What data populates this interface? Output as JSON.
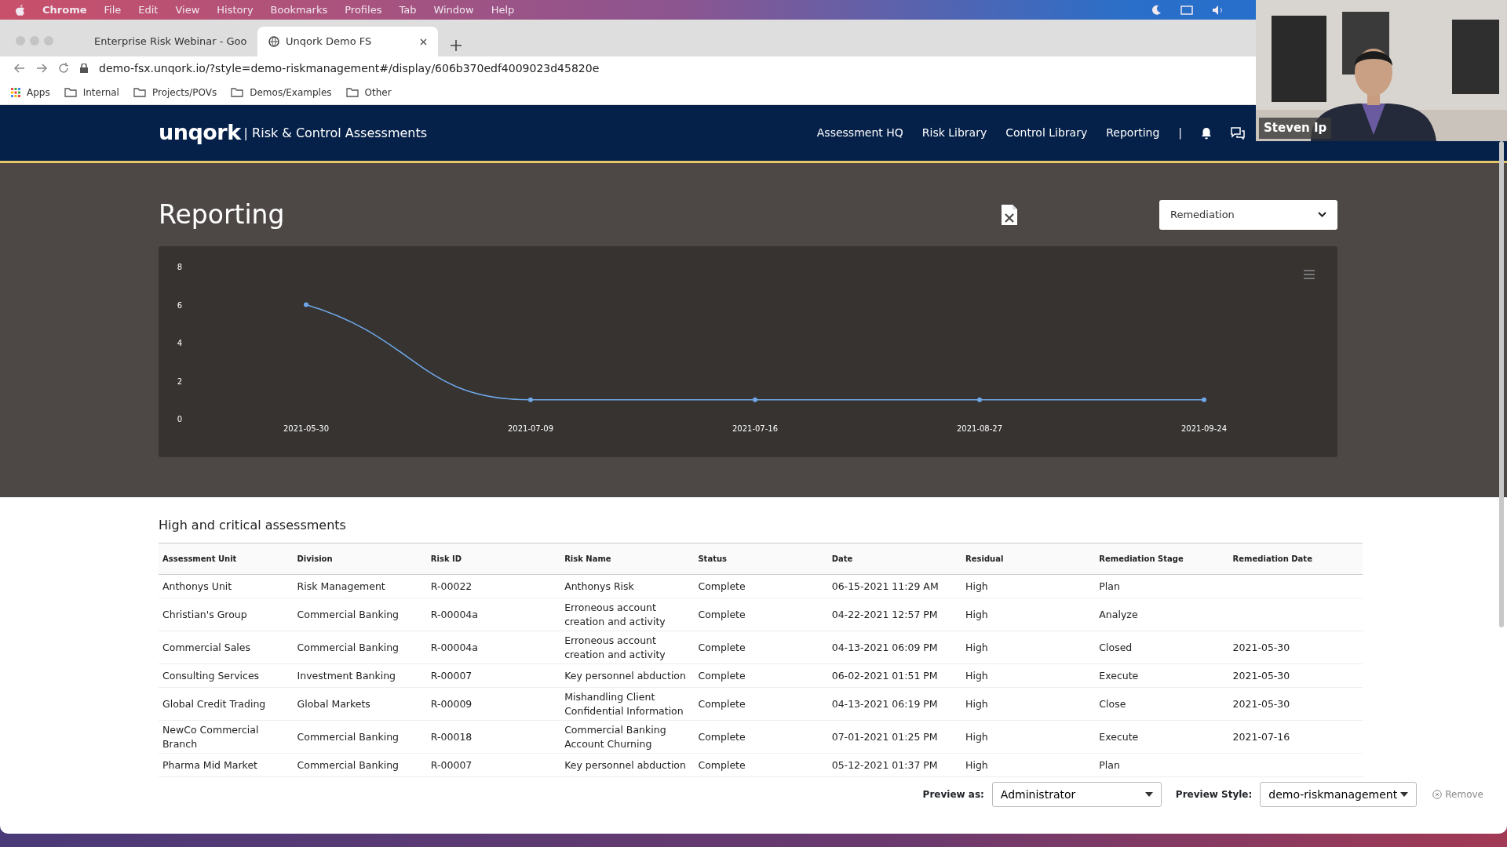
{
  "menubar": {
    "app": "Chrome",
    "items": [
      "File",
      "Edit",
      "View",
      "History",
      "Bookmarks",
      "Profiles",
      "Tab",
      "Window",
      "Help"
    ]
  },
  "browser": {
    "tabs": [
      {
        "title": "Enterprise Risk Webinar - Goo",
        "selected": false
      },
      {
        "title": "Unqork Demo FS",
        "selected": true
      }
    ],
    "url": "demo-fsx.unqork.io/?style=demo-riskmanagement#/display/606b370edf4009023d45820e",
    "bookmarks": [
      {
        "label": "Apps",
        "kind": "apps"
      },
      {
        "label": "Internal",
        "kind": "folder"
      },
      {
        "label": "Projects/POVs",
        "kind": "folder"
      },
      {
        "label": "Demos/Examples",
        "kind": "folder"
      },
      {
        "label": "Other",
        "kind": "folder"
      }
    ]
  },
  "app": {
    "logo": "unqork",
    "subtitle": "| Risk & Control Assessments",
    "nav": [
      "Assessment HQ",
      "Risk Library",
      "Control Library",
      "Reporting"
    ],
    "separator": "|"
  },
  "page": {
    "title": "Reporting",
    "report_select": "Remediation",
    "chart_data": {
      "type": "line",
      "categories": [
        "2021-05-30",
        "2021-07-09",
        "2021-07-16",
        "2021-08-27",
        "2021-09-24"
      ],
      "series": [
        {
          "color": "#6fa8e8",
          "marker": "circle",
          "values": [
            6,
            1,
            1,
            1,
            1
          ]
        }
      ],
      "ylim": [
        0,
        8
      ],
      "yticks": [
        0,
        2,
        4,
        6,
        8
      ]
    }
  },
  "assessments": {
    "title": "High and critical assessments",
    "columns": [
      "Assessment Unit",
      "Division",
      "Risk ID",
      "Risk Name",
      "Status",
      "Date",
      "Residual",
      "Remediation Stage",
      "Remediation Date"
    ],
    "rows": [
      [
        "Anthonys Unit",
        "Risk Management",
        "R-00022",
        "Anthonys Risk",
        "Complete",
        "06-15-2021 11:29 AM",
        "High",
        "Plan",
        ""
      ],
      [
        "Christian's Group",
        "Commercial Banking",
        "R-00004a",
        "Erroneous account creation and activity",
        "Complete",
        "04-22-2021 12:57 PM",
        "High",
        "Analyze",
        ""
      ],
      [
        "Commercial Sales",
        "Commercial Banking",
        "R-00004a",
        "Erroneous account creation and activity",
        "Complete",
        "04-13-2021 06:09 PM",
        "High",
        "Closed",
        "2021-05-30"
      ],
      [
        "Consulting Services",
        "Investment Banking",
        "R-00007",
        "Key personnel abduction",
        "Complete",
        "06-02-2021 01:51 PM",
        "High",
        "Execute",
        "2021-05-30"
      ],
      [
        "Global Credit Trading",
        "Global Markets",
        "R-00009",
        "Mishandling Client Confidential Information",
        "Complete",
        "04-13-2021 06:19 PM",
        "High",
        "Close",
        "2021-05-30"
      ],
      [
        "NewCo Commercial Branch",
        "Commercial Banking",
        "R-00018",
        "Commercial Banking Account Churning",
        "Complete",
        "07-01-2021 01:25 PM",
        "High",
        "Execute",
        "2021-07-16"
      ],
      [
        "Pharma Mid Market",
        "Commercial Banking",
        "R-00007",
        "Key personnel abduction",
        "Complete",
        "05-12-2021 01:37 PM",
        "High",
        "Plan",
        ""
      ]
    ]
  },
  "preview": {
    "as_label": "Preview as:",
    "as_value": "Administrator",
    "style_label": "Preview Style:",
    "style_value": "demo-riskmanagement",
    "remove": "Remove"
  },
  "webcam": {
    "kind": "picture",
    "name": "Steven Ip"
  }
}
